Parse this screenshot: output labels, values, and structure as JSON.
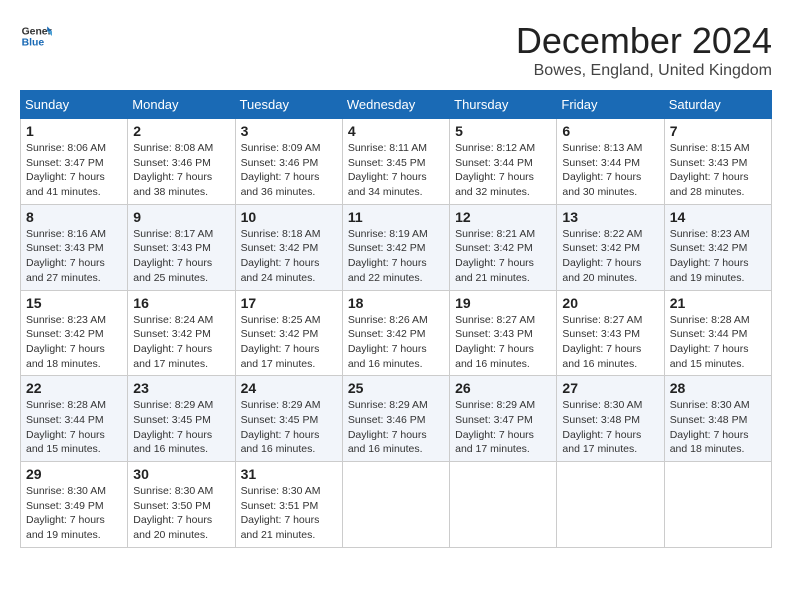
{
  "logo": {
    "line1": "General",
    "line2": "Blue"
  },
  "title": "December 2024",
  "subtitle": "Bowes, England, United Kingdom",
  "days_of_week": [
    "Sunday",
    "Monday",
    "Tuesday",
    "Wednesday",
    "Thursday",
    "Friday",
    "Saturday"
  ],
  "weeks": [
    [
      {
        "day": "1",
        "sunrise": "Sunrise: 8:06 AM",
        "sunset": "Sunset: 3:47 PM",
        "daylight": "Daylight: 7 hours and 41 minutes."
      },
      {
        "day": "2",
        "sunrise": "Sunrise: 8:08 AM",
        "sunset": "Sunset: 3:46 PM",
        "daylight": "Daylight: 7 hours and 38 minutes."
      },
      {
        "day": "3",
        "sunrise": "Sunrise: 8:09 AM",
        "sunset": "Sunset: 3:46 PM",
        "daylight": "Daylight: 7 hours and 36 minutes."
      },
      {
        "day": "4",
        "sunrise": "Sunrise: 8:11 AM",
        "sunset": "Sunset: 3:45 PM",
        "daylight": "Daylight: 7 hours and 34 minutes."
      },
      {
        "day": "5",
        "sunrise": "Sunrise: 8:12 AM",
        "sunset": "Sunset: 3:44 PM",
        "daylight": "Daylight: 7 hours and 32 minutes."
      },
      {
        "day": "6",
        "sunrise": "Sunrise: 8:13 AM",
        "sunset": "Sunset: 3:44 PM",
        "daylight": "Daylight: 7 hours and 30 minutes."
      },
      {
        "day": "7",
        "sunrise": "Sunrise: 8:15 AM",
        "sunset": "Sunset: 3:43 PM",
        "daylight": "Daylight: 7 hours and 28 minutes."
      }
    ],
    [
      {
        "day": "8",
        "sunrise": "Sunrise: 8:16 AM",
        "sunset": "Sunset: 3:43 PM",
        "daylight": "Daylight: 7 hours and 27 minutes."
      },
      {
        "day": "9",
        "sunrise": "Sunrise: 8:17 AM",
        "sunset": "Sunset: 3:43 PM",
        "daylight": "Daylight: 7 hours and 25 minutes."
      },
      {
        "day": "10",
        "sunrise": "Sunrise: 8:18 AM",
        "sunset": "Sunset: 3:42 PM",
        "daylight": "Daylight: 7 hours and 24 minutes."
      },
      {
        "day": "11",
        "sunrise": "Sunrise: 8:19 AM",
        "sunset": "Sunset: 3:42 PM",
        "daylight": "Daylight: 7 hours and 22 minutes."
      },
      {
        "day": "12",
        "sunrise": "Sunrise: 8:21 AM",
        "sunset": "Sunset: 3:42 PM",
        "daylight": "Daylight: 7 hours and 21 minutes."
      },
      {
        "day": "13",
        "sunrise": "Sunrise: 8:22 AM",
        "sunset": "Sunset: 3:42 PM",
        "daylight": "Daylight: 7 hours and 20 minutes."
      },
      {
        "day": "14",
        "sunrise": "Sunrise: 8:23 AM",
        "sunset": "Sunset: 3:42 PM",
        "daylight": "Daylight: 7 hours and 19 minutes."
      }
    ],
    [
      {
        "day": "15",
        "sunrise": "Sunrise: 8:23 AM",
        "sunset": "Sunset: 3:42 PM",
        "daylight": "Daylight: 7 hours and 18 minutes."
      },
      {
        "day": "16",
        "sunrise": "Sunrise: 8:24 AM",
        "sunset": "Sunset: 3:42 PM",
        "daylight": "Daylight: 7 hours and 17 minutes."
      },
      {
        "day": "17",
        "sunrise": "Sunrise: 8:25 AM",
        "sunset": "Sunset: 3:42 PM",
        "daylight": "Daylight: 7 hours and 17 minutes."
      },
      {
        "day": "18",
        "sunrise": "Sunrise: 8:26 AM",
        "sunset": "Sunset: 3:42 PM",
        "daylight": "Daylight: 7 hours and 16 minutes."
      },
      {
        "day": "19",
        "sunrise": "Sunrise: 8:27 AM",
        "sunset": "Sunset: 3:43 PM",
        "daylight": "Daylight: 7 hours and 16 minutes."
      },
      {
        "day": "20",
        "sunrise": "Sunrise: 8:27 AM",
        "sunset": "Sunset: 3:43 PM",
        "daylight": "Daylight: 7 hours and 16 minutes."
      },
      {
        "day": "21",
        "sunrise": "Sunrise: 8:28 AM",
        "sunset": "Sunset: 3:44 PM",
        "daylight": "Daylight: 7 hours and 15 minutes."
      }
    ],
    [
      {
        "day": "22",
        "sunrise": "Sunrise: 8:28 AM",
        "sunset": "Sunset: 3:44 PM",
        "daylight": "Daylight: 7 hours and 15 minutes."
      },
      {
        "day": "23",
        "sunrise": "Sunrise: 8:29 AM",
        "sunset": "Sunset: 3:45 PM",
        "daylight": "Daylight: 7 hours and 16 minutes."
      },
      {
        "day": "24",
        "sunrise": "Sunrise: 8:29 AM",
        "sunset": "Sunset: 3:45 PM",
        "daylight": "Daylight: 7 hours and 16 minutes."
      },
      {
        "day": "25",
        "sunrise": "Sunrise: 8:29 AM",
        "sunset": "Sunset: 3:46 PM",
        "daylight": "Daylight: 7 hours and 16 minutes."
      },
      {
        "day": "26",
        "sunrise": "Sunrise: 8:29 AM",
        "sunset": "Sunset: 3:47 PM",
        "daylight": "Daylight: 7 hours and 17 minutes."
      },
      {
        "day": "27",
        "sunrise": "Sunrise: 8:30 AM",
        "sunset": "Sunset: 3:48 PM",
        "daylight": "Daylight: 7 hours and 17 minutes."
      },
      {
        "day": "28",
        "sunrise": "Sunrise: 8:30 AM",
        "sunset": "Sunset: 3:48 PM",
        "daylight": "Daylight: 7 hours and 18 minutes."
      }
    ],
    [
      {
        "day": "29",
        "sunrise": "Sunrise: 8:30 AM",
        "sunset": "Sunset: 3:49 PM",
        "daylight": "Daylight: 7 hours and 19 minutes."
      },
      {
        "day": "30",
        "sunrise": "Sunrise: 8:30 AM",
        "sunset": "Sunset: 3:50 PM",
        "daylight": "Daylight: 7 hours and 20 minutes."
      },
      {
        "day": "31",
        "sunrise": "Sunrise: 8:30 AM",
        "sunset": "Sunset: 3:51 PM",
        "daylight": "Daylight: 7 hours and 21 minutes."
      },
      null,
      null,
      null,
      null
    ]
  ]
}
